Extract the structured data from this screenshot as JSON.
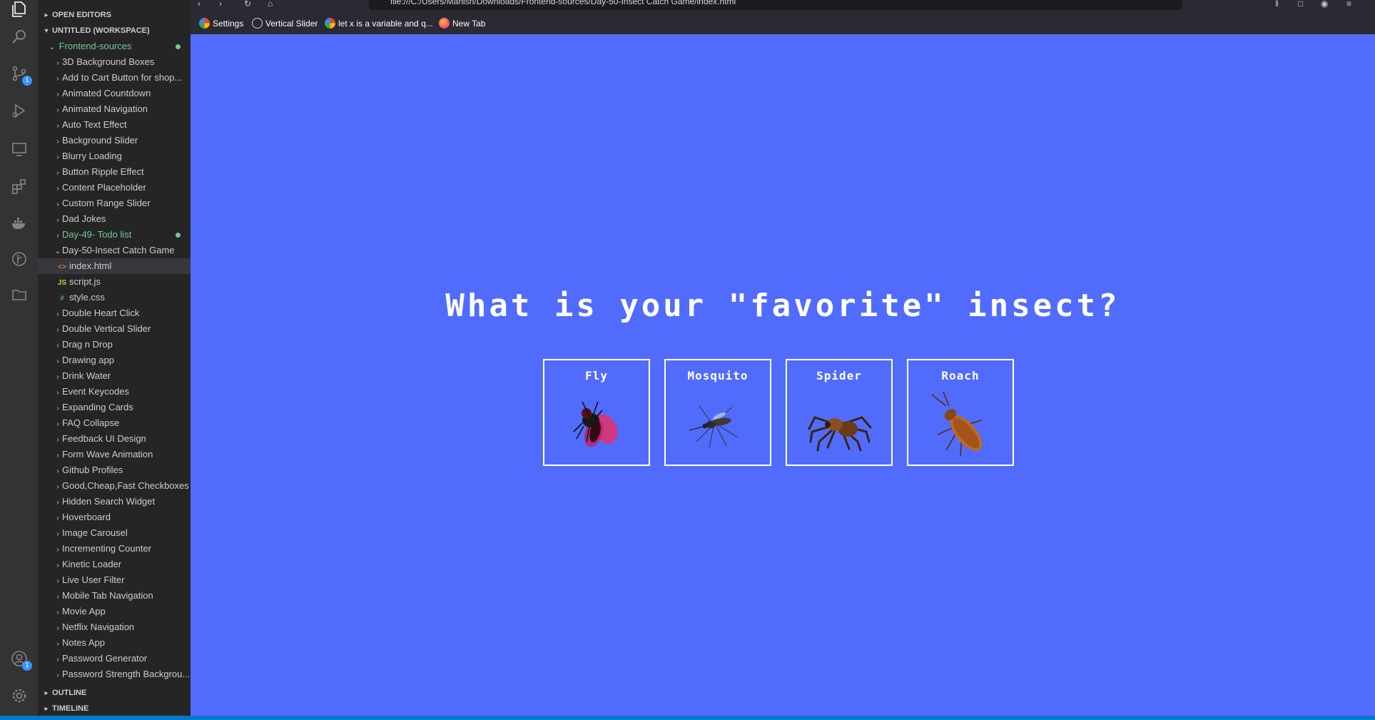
{
  "explorer": {
    "open_editors": "OPEN EDITORS",
    "workspace": "UNTITLED (WORKSPACE)",
    "root_folder": "Frontend-sources",
    "items": [
      {
        "label": "3D Background Boxes"
      },
      {
        "label": "Add to Cart Button for shop..."
      },
      {
        "label": "Animated Countdown"
      },
      {
        "label": "Animated Navigation"
      },
      {
        "label": "Auto Text Effect"
      },
      {
        "label": "Background Slider"
      },
      {
        "label": "Blurry Loading"
      },
      {
        "label": "Button Ripple Effect"
      },
      {
        "label": "Content Placeholder"
      },
      {
        "label": "Custom Range Slider"
      },
      {
        "label": "Dad Jokes"
      },
      {
        "label": "Day-49- Todo list"
      },
      {
        "label": "Day-50-Insect Catch Game"
      }
    ],
    "files": [
      {
        "label": "index.html",
        "icon": "<>"
      },
      {
        "label": "script.js",
        "icon": "JS"
      },
      {
        "label": "style.css",
        "icon": "#"
      }
    ],
    "items_after": [
      {
        "label": "Double Heart Click"
      },
      {
        "label": "Double Vertical Slider"
      },
      {
        "label": "Drag n Drop"
      },
      {
        "label": "Drawing app"
      },
      {
        "label": "Drink Water"
      },
      {
        "label": "Event Keycodes"
      },
      {
        "label": "Expanding Cards"
      },
      {
        "label": "FAQ Collapse"
      },
      {
        "label": "Feedback UI Design"
      },
      {
        "label": "Form Wave Animation"
      },
      {
        "label": "Github Profiles"
      },
      {
        "label": "Good,Cheap,Fast Checkboxes"
      },
      {
        "label": "Hidden Search Widget"
      },
      {
        "label": "Hoverboard"
      },
      {
        "label": "Image Carousel"
      },
      {
        "label": "Incrementing Counter"
      },
      {
        "label": "Kinetic Loader"
      },
      {
        "label": "Live User Filter"
      },
      {
        "label": "Mobile Tab Navigation"
      },
      {
        "label": "Movie App"
      },
      {
        "label": "Netflix Navigation"
      },
      {
        "label": "Notes App"
      },
      {
        "label": "Password Generator"
      },
      {
        "label": "Password Strength Backgrou..."
      }
    ],
    "outline": "OUTLINE",
    "timeline": "TIMELINE"
  },
  "activity": {
    "scm_badge": "1",
    "accounts_badge": "1"
  },
  "browser": {
    "url": "file:///C:/Users/Manish/Downloads/Frontend-sources/Day-50-Insect Catch Game/index.html",
    "bookmarks": [
      {
        "label": "Settings",
        "icon": "google-icon"
      },
      {
        "label": "Vertical Slider",
        "icon": "globe-icon"
      },
      {
        "label": "let x is a variable and q...",
        "icon": "google-icon"
      },
      {
        "label": "New Tab",
        "icon": "firefox-icon"
      }
    ]
  },
  "page": {
    "heading": "What is your \"favorite\" insect?",
    "insects": [
      {
        "name": "Fly"
      },
      {
        "name": "Mosquito"
      },
      {
        "name": "Spider"
      },
      {
        "name": "Roach"
      }
    ],
    "background": "#516cfc"
  }
}
